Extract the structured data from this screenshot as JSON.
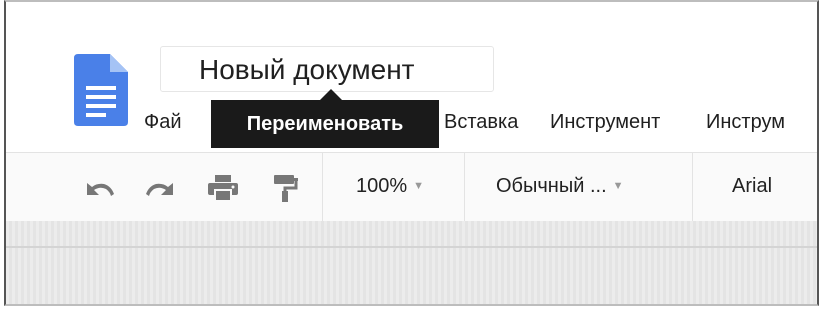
{
  "app": {
    "document_title": "Новый документ"
  },
  "menu": {
    "items": [
      "Фай",
      "Вставка",
      "Инструмент",
      "Инструм"
    ]
  },
  "tooltip": {
    "text": "Переименовать"
  },
  "toolbar": {
    "icons": [
      "undo-icon",
      "redo-icon",
      "print-icon",
      "paint-format-icon"
    ],
    "zoom": "100%",
    "style": "Обычный ...",
    "font": "Arial"
  },
  "colors": {
    "docs_blue": "#4a80e8",
    "docs_fold": "#a5c3f5",
    "icon_gray": "#777777",
    "tooltip_bg": "#1a1a1a"
  }
}
